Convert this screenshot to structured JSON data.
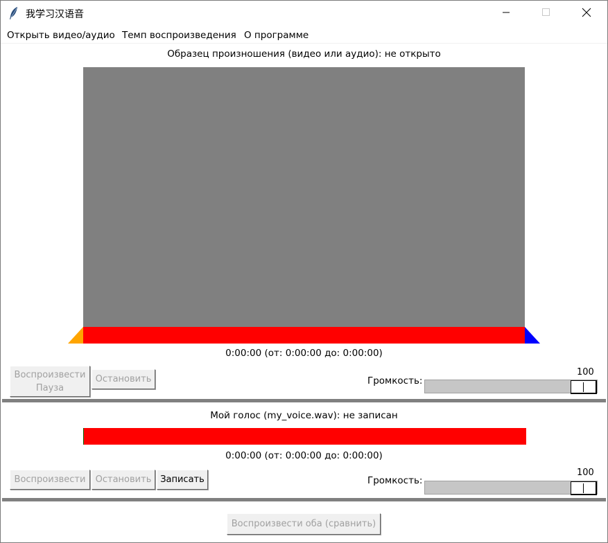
{
  "window": {
    "title": "我学习汉语音",
    "minimize_glyph": "—",
    "maximize_glyph": "☐",
    "close_glyph": "✕"
  },
  "menu": [
    {
      "label": "Открыть видео/аудио"
    },
    {
      "label": "Темп воспроизведения"
    },
    {
      "label": "О программе"
    }
  ],
  "sample": {
    "header": "Образец произношения (видео или аудио): не открыто",
    "time_text": "0:00:00 (от: 0:00:00 до: 0:00:00)",
    "play_pause_line1": "Воспроизвести",
    "play_pause_line2": "Пауза",
    "stop_label": "Остановить",
    "volume_label": "Громкость:",
    "volume_value": "100",
    "volume_level": 100,
    "video_color": "#808080",
    "progress_color": "#ff0000",
    "start_marker_color": "#ffa500",
    "end_marker_color": "#0000ff"
  },
  "my_voice": {
    "header": "Мой голос (my_voice.wav): не записан",
    "time_text": "0:00:00 (от: 0:00:00 до: 0:00:00)",
    "play_label": "Воспроизвести",
    "stop_label": "Остановить",
    "record_label": "Записать",
    "volume_label": "Громкость:",
    "volume_value": "100",
    "volume_level": 100,
    "progress_color": "#ff0000"
  },
  "compare": {
    "play_both_label": "Воспроизвести оба (сравнить)"
  }
}
